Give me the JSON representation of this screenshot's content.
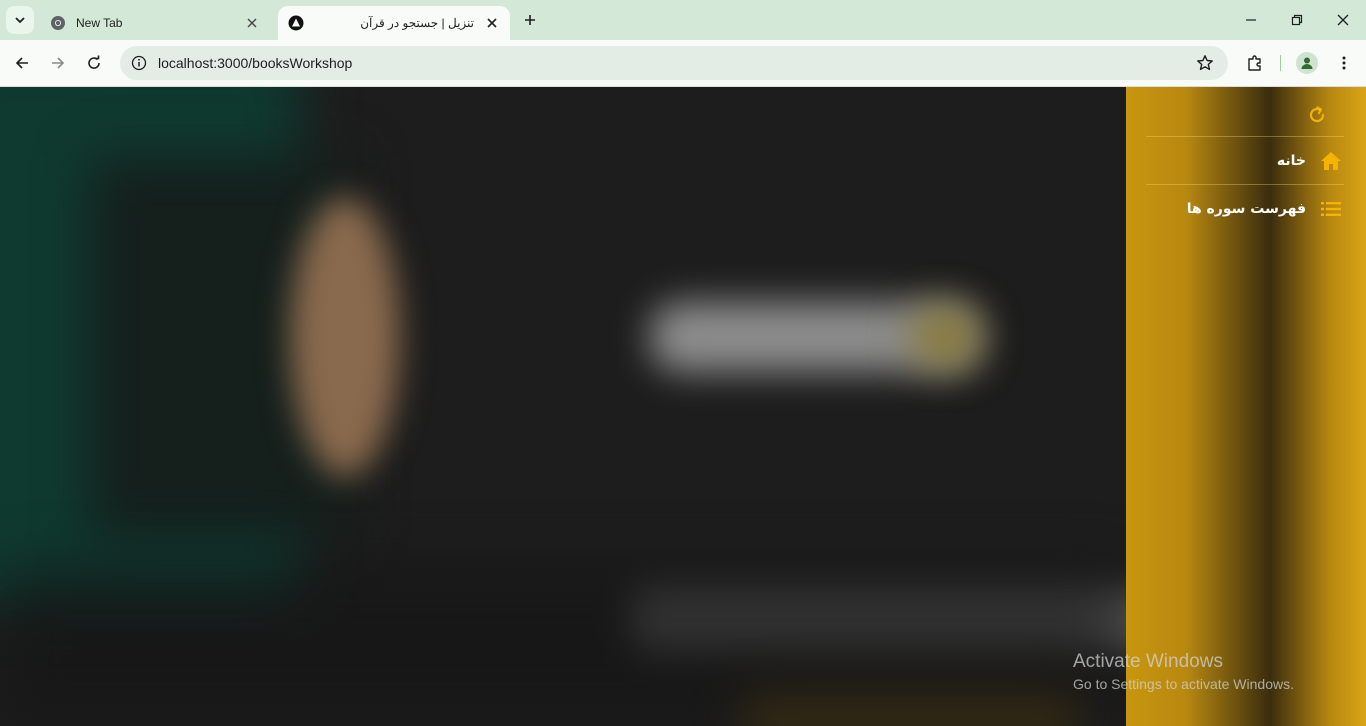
{
  "browser": {
    "tabs": [
      {
        "title": "New Tab",
        "active": false
      },
      {
        "title": "تنزیل | جستجو در قرآن",
        "active": true
      }
    ],
    "address_url": "localhost:3000/booksWorkshop",
    "icons": {
      "tab_search": "chevron-down-icon",
      "new_tab": "plus-icon",
      "back": "arrow-left-icon",
      "forward": "arrow-right-icon",
      "reload": "reload-icon",
      "site_info": "info-icon",
      "bookmark": "star-icon",
      "extensions": "puzzle-icon",
      "profile": "person-icon",
      "menu": "kebab-icon"
    }
  },
  "sidebar": {
    "refresh_icon": "refresh-icon",
    "items": [
      {
        "label": "خانه",
        "icon": "home-icon"
      },
      {
        "label": "فهرست سوره ها",
        "icon": "list-icon"
      }
    ],
    "accent_color": "#f5b400"
  },
  "watermark": {
    "line1": "Activate Windows",
    "line2": "Go to Settings to activate Windows."
  }
}
